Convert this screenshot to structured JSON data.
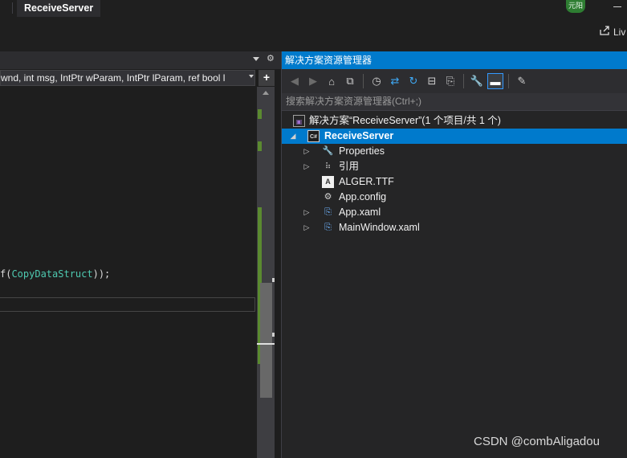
{
  "titlebar": {
    "active_document": "ReceiveServer",
    "avatar_text": "元阳"
  },
  "live_share": {
    "label": "Liv"
  },
  "editor": {
    "navigation_dropdown": "wnd, int msg, IntPtr wParam, IntPtr lParam, ref bool l",
    "code_prefix": "f(",
    "code_type": "CopyDataStruct",
    "code_suffix": "));",
    "split_button": "+"
  },
  "solution_explorer": {
    "title": "解决方案资源管理器",
    "search_placeholder": "搜索解决方案资源管理器(Ctrl+;)",
    "toolbar": [
      {
        "name": "back-icon",
        "glyph": "◀",
        "state": "dim"
      },
      {
        "name": "forward-icon",
        "glyph": "▶",
        "state": "dim"
      },
      {
        "name": "home-icon",
        "glyph": "⌂",
        "state": "normal"
      },
      {
        "name": "vs-switch-views-icon",
        "glyph": "⧉",
        "state": "normal"
      },
      {
        "name": "pending-changes-icon",
        "glyph": "◷",
        "state": "normal"
      },
      {
        "name": "sync-icon",
        "glyph": "⇄",
        "state": "blue"
      },
      {
        "name": "refresh-icon",
        "glyph": "↻",
        "state": "blue"
      },
      {
        "name": "collapse-all-icon",
        "glyph": "⊟",
        "state": "normal"
      },
      {
        "name": "show-all-files-icon",
        "glyph": "⎘",
        "state": "normal"
      },
      {
        "name": "properties-icon",
        "glyph": "🔧",
        "state": "normal"
      },
      {
        "name": "preview-selected-icon",
        "glyph": "▬",
        "state": "active"
      },
      {
        "name": "class-view-icon",
        "glyph": "✎",
        "state": "normal"
      }
    ],
    "tree": [
      {
        "label": "解决方案“ReceiveServer”(1 个项目/共 1 个)",
        "icon": "solution-icon",
        "expander": ""
      },
      {
        "label": "ReceiveServer",
        "icon": "csharp-project-icon",
        "expander": "◢",
        "selected": true
      },
      {
        "label": "Properties",
        "icon": "wrench-icon",
        "expander": "▷"
      },
      {
        "label": "引用",
        "icon": "references-icon",
        "expander": "▷"
      },
      {
        "label": "ALGER.TTF",
        "icon": "font-file-icon",
        "expander": ""
      },
      {
        "label": "App.config",
        "icon": "config-file-icon",
        "expander": ""
      },
      {
        "label": "App.xaml",
        "icon": "xaml-file-icon",
        "expander": "▷"
      },
      {
        "label": "MainWindow.xaml",
        "icon": "xaml-file-icon",
        "expander": "▷"
      }
    ]
  },
  "watermark": "CSDN @combAligadou"
}
